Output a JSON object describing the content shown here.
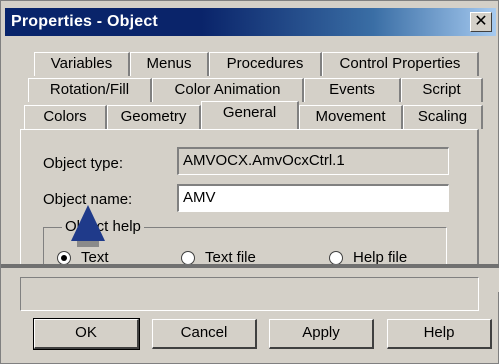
{
  "window": {
    "title": "Properties - Object",
    "close_glyph": "✕"
  },
  "tabs": {
    "row1": [
      "Variables",
      "Menus",
      "Procedures",
      "Control Properties"
    ],
    "row2": [
      "Rotation/Fill",
      "Color Animation",
      "Events",
      "Script"
    ],
    "row3": [
      "Colors",
      "Geometry",
      "General",
      "Movement",
      "Scaling"
    ],
    "active": "General"
  },
  "general": {
    "object_type_label": "Object type:",
    "object_type_value": "AMVOCX.AmvOcxCtrl.1",
    "object_name_label": "Object name:",
    "object_name_value": "AMV",
    "help_group_label": "Object help",
    "help_options": [
      {
        "label": "Text",
        "selected": true
      },
      {
        "label": "Text file",
        "selected": false
      },
      {
        "label": "Help file",
        "selected": false
      }
    ]
  },
  "buttons": {
    "ok": "OK",
    "cancel": "Cancel",
    "apply": "Apply",
    "help": "Help"
  },
  "colors": {
    "titlebar_start": "#0a246a",
    "titlebar_end": "#a6caf0",
    "face": "#d4d0c8",
    "cursor": "#1f3a8a"
  }
}
